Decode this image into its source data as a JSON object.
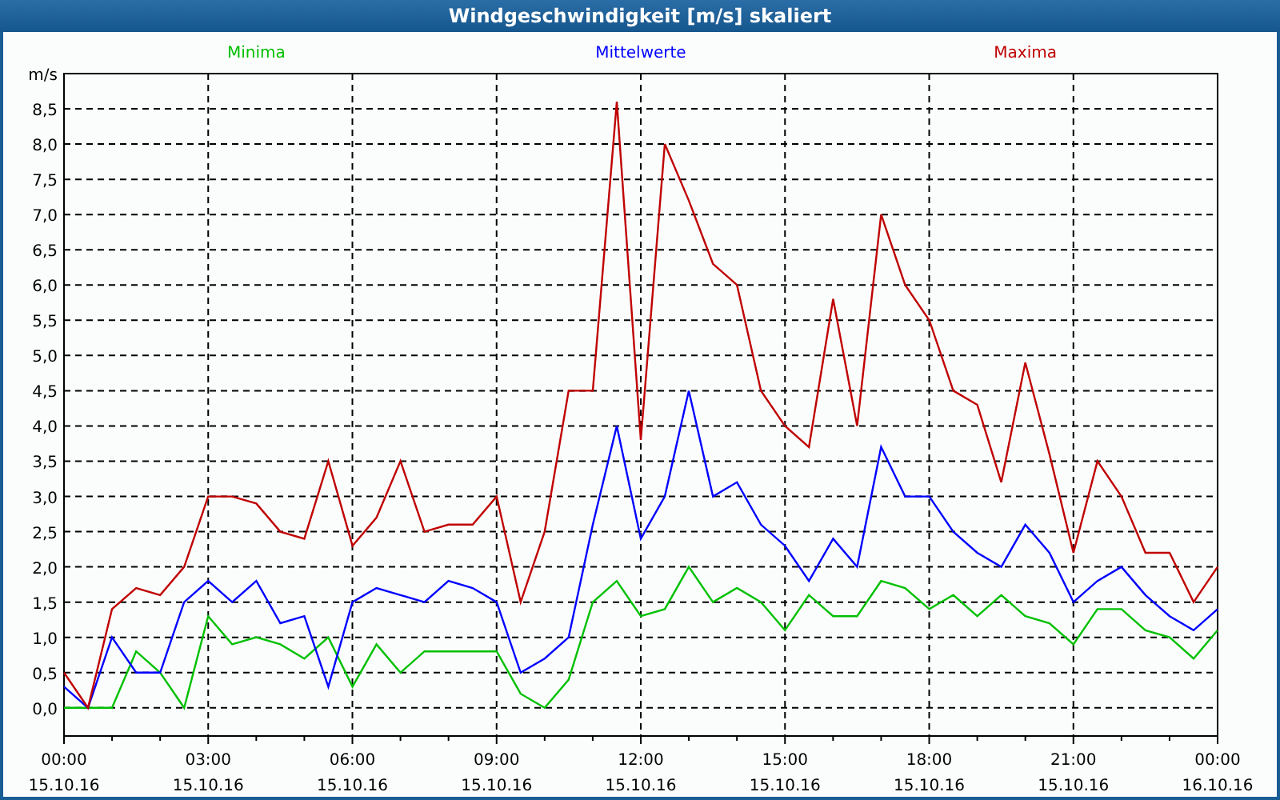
{
  "window": {
    "title": "Windgeschwindigkeit [m/s] skaliert"
  },
  "chart_data": {
    "type": "line",
    "ylabel": "m/s",
    "categories": [
      "00:00\n15.10.16",
      null,
      null,
      null,
      null,
      null,
      "03:00\n15.10.16",
      null,
      null,
      null,
      null,
      null,
      "06:00\n15.10.16",
      null,
      null,
      null,
      null,
      null,
      "09:00\n15.10.16",
      null,
      null,
      null,
      null,
      null,
      "12:00\n15.10.16",
      null,
      null,
      null,
      null,
      null,
      "15:00\n15.10.16",
      null,
      null,
      null,
      null,
      null,
      "18:00\n15.10.16",
      null,
      null,
      null,
      null,
      null,
      "21:00\n15.10.16",
      null,
      null,
      null,
      null,
      null,
      "00:00\n16.10.16"
    ],
    "series": [
      {
        "name": "Minima",
        "color": "#00c000",
        "values": [
          0,
          0,
          0,
          0.8,
          0.5,
          0,
          1.3,
          0.9,
          1.0,
          0.9,
          0.7,
          1.0,
          0.3,
          0.9,
          0.5,
          0.8,
          0.8,
          0.8,
          0.8,
          0.2,
          0,
          0.4,
          1.5,
          1.8,
          1.3,
          1.4,
          2.0,
          1.5,
          1.7,
          1.5,
          1.1,
          1.6,
          1.3,
          1.3,
          1.8,
          1.7,
          1.4,
          1.6,
          1.3,
          1.6,
          1.3,
          1.2,
          0.9,
          1.4,
          1.4,
          1.1,
          1.0,
          0.7,
          1.1
        ]
      },
      {
        "name": "Mittelwerte",
        "color": "#0000ff",
        "values": [
          0.3,
          0,
          1.0,
          0.5,
          0.5,
          1.5,
          1.8,
          1.5,
          1.8,
          1.2,
          1.3,
          0.3,
          1.5,
          1.7,
          1.6,
          1.5,
          1.8,
          1.7,
          1.5,
          0.5,
          0.7,
          1.0,
          2.6,
          4.0,
          2.4,
          3.0,
          4.5,
          3.0,
          3.2,
          2.6,
          2.3,
          1.8,
          2.4,
          2.0,
          3.7,
          3.0,
          3.0,
          2.5,
          2.2,
          2.0,
          2.6,
          2.2,
          1.5,
          1.8,
          2.0,
          1.6,
          1.3,
          1.1,
          1.4
        ]
      },
      {
        "name": "Maxima",
        "color": "#c00000",
        "values": [
          0.5,
          0,
          1.4,
          1.7,
          1.6,
          2.0,
          3.0,
          3.0,
          2.9,
          2.5,
          2.4,
          3.5,
          2.3,
          2.7,
          3.5,
          2.5,
          2.6,
          2.6,
          3.0,
          1.5,
          2.5,
          4.5,
          4.5,
          8.6,
          3.8,
          8.0,
          7.2,
          6.3,
          6.0,
          4.5,
          4.0,
          3.7,
          5.8,
          4.0,
          7.0,
          6.0,
          5.5,
          4.5,
          4.3,
          3.2,
          4.9,
          3.6,
          2.2,
          3.5,
          3.0,
          2.2,
          2.2,
          1.5,
          2.0
        ]
      }
    ],
    "ylim": [
      -0.4,
      9
    ],
    "grid": true,
    "yticks": [
      {
        "value": 0,
        "label": "0,0"
      },
      {
        "value": 0.5,
        "label": "0,5"
      },
      {
        "value": 1,
        "label": "1,0"
      },
      {
        "value": 1.5,
        "label": "1,5"
      },
      {
        "value": 2,
        "label": "2,0"
      },
      {
        "value": 2.5,
        "label": "2,5"
      },
      {
        "value": 3,
        "label": "3,0"
      },
      {
        "value": 3.5,
        "label": "3,5"
      },
      {
        "value": 4,
        "label": "4,0"
      },
      {
        "value": 4.5,
        "label": "4,5"
      },
      {
        "value": 5,
        "label": "5,0"
      },
      {
        "value": 5.5,
        "label": "5,5"
      },
      {
        "value": 6,
        "label": "6,0"
      },
      {
        "value": 6.5,
        "label": "6,5"
      },
      {
        "value": 7,
        "label": "7,0"
      },
      {
        "value": 7.5,
        "label": "7,5"
      },
      {
        "value": 8,
        "label": "8,0"
      },
      {
        "value": 8.5,
        "label": "8,5"
      }
    ]
  }
}
